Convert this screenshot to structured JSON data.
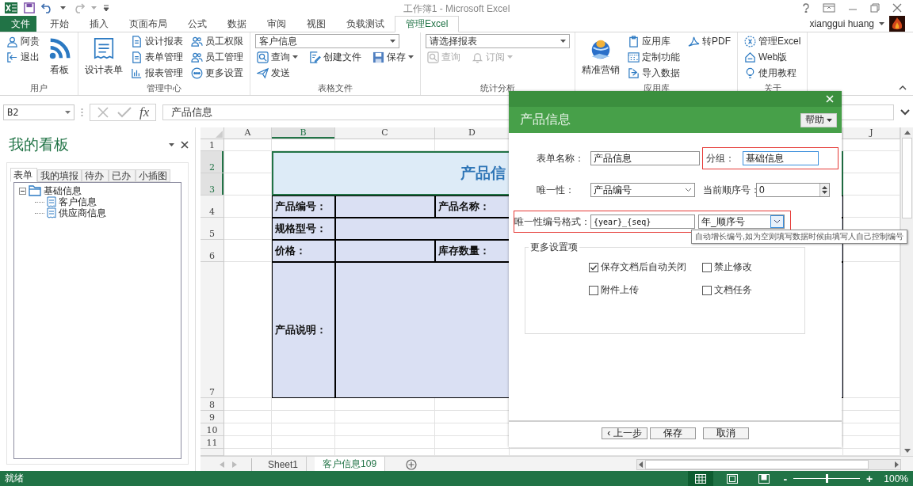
{
  "window": {
    "title": "工作簿1 - Microsoft Excel",
    "user": "xianggui huang"
  },
  "ribbon_tabs": [
    {
      "label": "文件",
      "kind": "file",
      "selected": false
    },
    {
      "label": "开始",
      "kind": "tab",
      "selected": false
    },
    {
      "label": "插入",
      "kind": "tab",
      "selected": false
    },
    {
      "label": "页面布局",
      "kind": "tab",
      "selected": false
    },
    {
      "label": "公式",
      "kind": "tab",
      "selected": false
    },
    {
      "label": "数据",
      "kind": "tab",
      "selected": false
    },
    {
      "label": "审阅",
      "kind": "tab",
      "selected": false
    },
    {
      "label": "视图",
      "kind": "tab",
      "selected": false
    },
    {
      "label": "负载测试",
      "kind": "tab",
      "selected": false
    },
    {
      "label": "管理Excel",
      "kind": "tab",
      "selected": true
    }
  ],
  "ribbon_groups": [
    {
      "label": "用户",
      "columns": [
        {
          "kind": "stack",
          "items": [
            {
              "label": "阿贵"
            },
            {
              "label": "退出"
            }
          ]
        },
        {
          "kind": "large",
          "label": "看板"
        }
      ]
    },
    {
      "label": "管理中心",
      "columns": [
        {
          "kind": "large",
          "label": "设计表单"
        },
        {
          "kind": "stack",
          "items": [
            {
              "label": "设计报表"
            },
            {
              "label": "表单管理"
            },
            {
              "label": "报表管理"
            }
          ]
        },
        {
          "kind": "stack",
          "items": [
            {
              "label": "员工权限"
            },
            {
              "label": "员工管理"
            },
            {
              "label": "更多设置"
            }
          ]
        }
      ]
    },
    {
      "label": "表格文件",
      "columns": [
        {
          "kind": "combo",
          "value": "客户信息",
          "rows": [
            [
              {
                "label": "查询",
                "menu": true,
                "disabled": false
              },
              {
                "label": "创建文件",
                "menu": false,
                "disabled": false
              },
              {
                "label": "保存",
                "menu": true,
                "disabled": false
              }
            ],
            [
              {
                "label": "发送",
                "menu": false,
                "disabled": false
              }
            ]
          ]
        }
      ]
    },
    {
      "label": "统计分析",
      "columns": [
        {
          "kind": "combo",
          "value": "请选择报表",
          "rows": [
            [
              {
                "label": "查询",
                "menu": false,
                "disabled": true
              },
              {
                "label": "订阅",
                "menu": true,
                "disabled": true
              }
            ]
          ]
        }
      ]
    },
    {
      "label": "应用库",
      "columns": [
        {
          "kind": "large",
          "label": "精准营销"
        },
        {
          "kind": "stack",
          "items": [
            {
              "label": "应用库"
            },
            {
              "label": "定制功能"
            },
            {
              "label": "导入数据"
            }
          ]
        },
        {
          "kind": "stack",
          "items": [
            {
              "label": "转PDF"
            }
          ]
        }
      ]
    },
    {
      "label": "关于",
      "columns": [
        {
          "kind": "stack",
          "items": [
            {
              "label": "管理Excel"
            },
            {
              "label": "Web版"
            },
            {
              "label": "使用教程"
            }
          ]
        }
      ]
    }
  ],
  "formula_bar": {
    "name_box": "B2",
    "function_label": "fx",
    "content": "产品信息"
  },
  "side_pane": {
    "title": "我的看板",
    "tabs": [
      {
        "label": "表单",
        "selected": true
      },
      {
        "label": "我的填报",
        "selected": false
      },
      {
        "label": "待办",
        "selected": false
      },
      {
        "label": "已办",
        "selected": false
      },
      {
        "label": "小插图",
        "selected": false
      }
    ],
    "tree": [
      {
        "label": "基础信息",
        "expanded": true,
        "children": [
          {
            "label": "客户信息"
          },
          {
            "label": "供应商信息"
          }
        ]
      }
    ]
  },
  "sheet": {
    "columns": [
      {
        "label": "A",
        "selected": false
      },
      {
        "label": "B",
        "selected": true
      },
      {
        "label": "C",
        "selected": false
      },
      {
        "label": "D",
        "selected": false
      },
      {
        "label": "J",
        "selected": false
      }
    ],
    "rows": [
      {
        "label": "1",
        "selected": false
      },
      {
        "label": "2",
        "selected": true
      },
      {
        "label": "3",
        "selected": true
      },
      {
        "label": "4",
        "selected": false
      },
      {
        "label": "5",
        "selected": false
      },
      {
        "label": "6",
        "selected": false
      },
      {
        "label": "7",
        "selected": false
      },
      {
        "label": "8",
        "selected": false
      },
      {
        "label": "9",
        "selected": false
      },
      {
        "label": "10",
        "selected": false
      },
      {
        "label": "11",
        "selected": false
      }
    ],
    "form": {
      "title": "产品信",
      "labels": [
        "产品编号：",
        "产品名称：",
        "规格型号：",
        "价格：",
        "库存数量：",
        "产品说明："
      ]
    }
  },
  "sheet_tabs": [
    {
      "label": "Sheet1",
      "selected": false
    },
    {
      "label": "客户信息109",
      "selected": true
    }
  ],
  "status_bar": {
    "status": "就绪",
    "views": [
      {
        "selected": true
      },
      {
        "selected": false
      },
      {
        "selected": false
      }
    ],
    "zoom": {
      "zoom_out": "-",
      "zoom_in": "+",
      "level": 0.5,
      "reading": "100%"
    }
  },
  "dialog": {
    "title": "产品信息",
    "help_button": "帮助",
    "fields": [
      {
        "kind": "text",
        "label": "表单名称：",
        "value": "产品信息",
        "highlighted": false
      },
      {
        "kind": "text",
        "label": "分组：",
        "value": "基础信息",
        "highlighted": true
      },
      {
        "kind": "select",
        "label": "唯一性：",
        "value": "产品编号",
        "highlighted": false
      },
      {
        "kind": "spinner",
        "label": "当前顺序号：",
        "value": "0",
        "highlighted": false
      },
      {
        "kind": "format",
        "label": "唯一性编号格式：",
        "value": "{year}_{seq}",
        "option": "年_顺序号",
        "highlighted": true
      }
    ],
    "tooltip": "自动增长编号,如为空则填写数据时候由填写人自己控制编号",
    "more_settings": {
      "legend": "更多设置项",
      "options": [
        {
          "label": "保存文档后自动关闭",
          "checked": true
        },
        {
          "label": "禁止修改",
          "checked": false
        },
        {
          "label": "附件上传",
          "checked": false
        },
        {
          "label": "文档任务",
          "checked": false
        }
      ]
    },
    "buttons": [
      {
        "label": "‹ 上一步"
      },
      {
        "label": "保存"
      },
      {
        "label": "取消"
      }
    ]
  }
}
